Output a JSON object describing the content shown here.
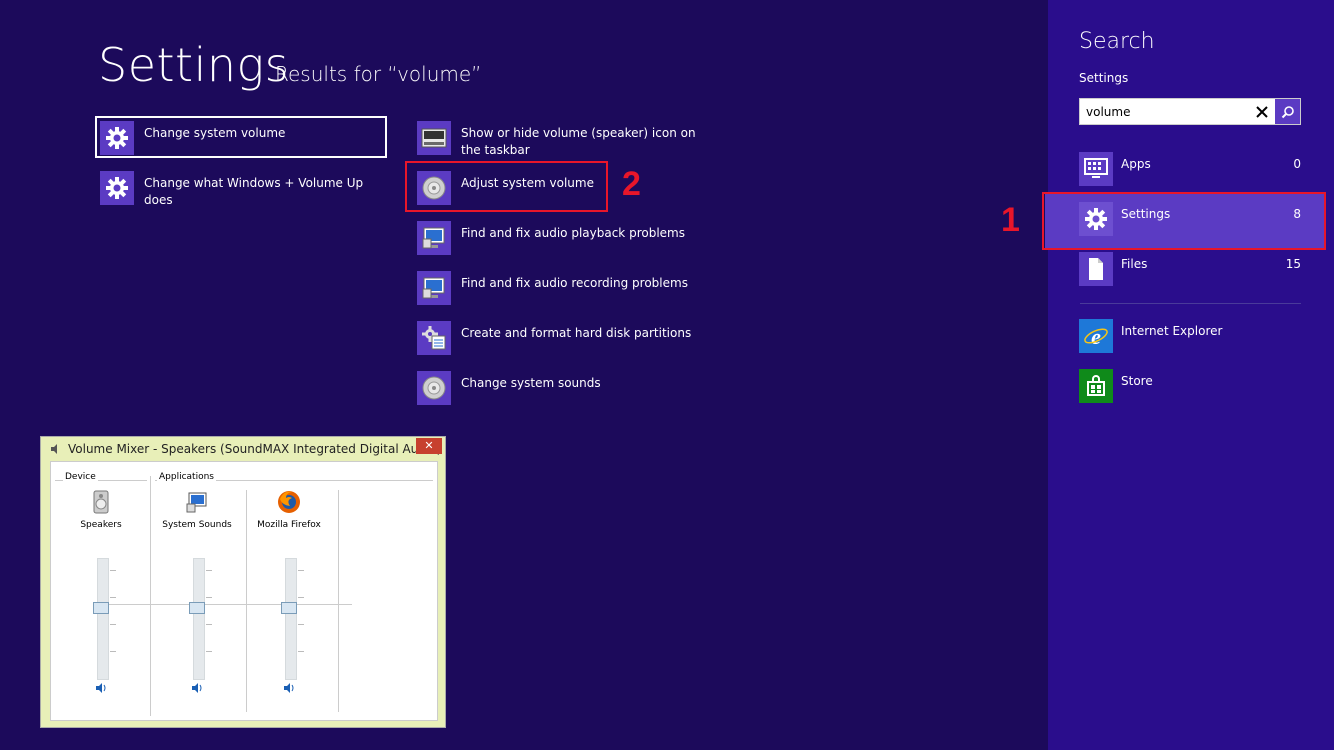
{
  "main": {
    "title": "Settings",
    "results_for": "Results for “volume”",
    "results": [
      {
        "label": "Change system volume",
        "icon": "gear-icon"
      },
      {
        "label": "Change what Windows + Volume Up does",
        "icon": "gear-icon"
      },
      {
        "label": "Show or hide volume (speaker) icon on the taskbar",
        "icon": "taskbar-icon"
      },
      {
        "label": "Adjust system volume",
        "icon": "speaker-icon"
      },
      {
        "label": "Find and fix audio playback problems",
        "icon": "troubleshoot-icon"
      },
      {
        "label": "Find and fix audio recording problems",
        "icon": "troubleshoot-icon"
      },
      {
        "label": "Create and format hard disk partitions",
        "icon": "disk-management-icon"
      },
      {
        "label": "Change system sounds",
        "icon": "speaker-icon"
      }
    ]
  },
  "annotations": {
    "step1": "1",
    "step2": "2",
    "color": "#e8162a"
  },
  "search_pane": {
    "title": "Search",
    "scope_label": "Settings",
    "query": "volume",
    "scopes": [
      {
        "label": "Apps",
        "count": "0",
        "icon": "apps-icon"
      },
      {
        "label": "Settings",
        "count": "8",
        "icon": "gear-icon",
        "selected": true
      },
      {
        "label": "Files",
        "count": "15",
        "icon": "file-icon"
      }
    ],
    "apps": [
      {
        "label": "Internet Explorer",
        "icon": "internet-explorer-icon"
      },
      {
        "label": "Store",
        "icon": "store-icon"
      }
    ]
  },
  "mixer": {
    "title": "Volume Mixer - Speakers (SoundMAX Integrated Digital Audio)",
    "close_label": "✕",
    "device_group": "Device",
    "apps_group": "Applications",
    "channels": [
      {
        "name": "Speakers",
        "icon": "speakers-icon",
        "level": 0.5
      },
      {
        "name": "System Sounds",
        "icon": "system-sounds-icon",
        "level": 0.5
      },
      {
        "name": "Mozilla Firefox",
        "icon": "firefox-icon",
        "level": 0.5
      }
    ]
  },
  "colors": {
    "background": "#1c0a5b",
    "pane": "#2a0d8c",
    "accent": "#5b3bc3"
  }
}
